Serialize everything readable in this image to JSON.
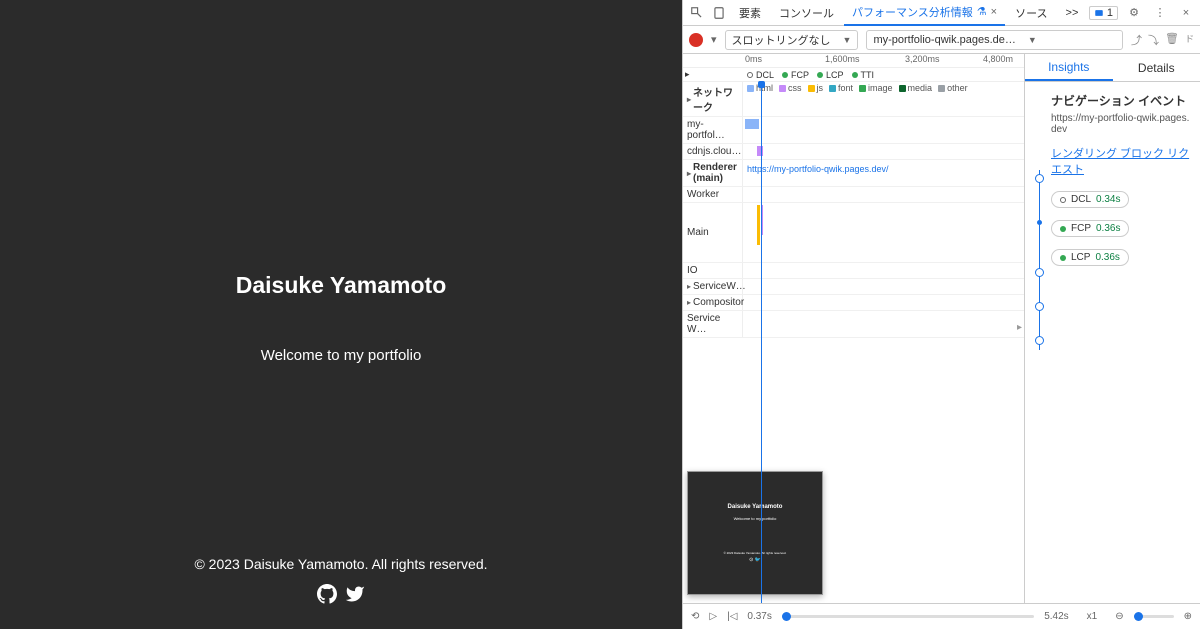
{
  "page": {
    "title": "Daisuke Yamamoto",
    "subtitle": "Welcome to my portfolio",
    "footer": "© 2023 Daisuke Yamamoto. All rights reserved."
  },
  "devtools": {
    "tabs": {
      "elements": "要素",
      "console": "コンソール",
      "perf": "パフォーマンス分析情報",
      "sources": "ソース",
      "more": ">>"
    },
    "warnings": "1",
    "toolbar": {
      "throttling": "スロットリングなし",
      "domain": "my-portfolio-qwik.pages.de…"
    },
    "ruler": {
      "t0": "0ms",
      "t1": "1,600ms",
      "t2": "3,200ms",
      "t3": "4,800m"
    },
    "metrics": {
      "dcl": "DCL",
      "fcp": "FCP",
      "lcp": "LCP",
      "tti": "TTI"
    },
    "tracks": {
      "network": "ネットワーク",
      "netItems": [
        "my-portfol…",
        "cdnjs.clou…"
      ],
      "renderer": "Renderer\n(main)",
      "rendererUrl": "https://my-portfolio-qwik.pages.dev/",
      "worker": "Worker",
      "main": "Main",
      "io": "IO",
      "servicew": "ServiceW…",
      "compositor": "Compositor",
      "servicew2": "Service W…"
    },
    "legend": {
      "html": "html",
      "css": "css",
      "js": "js",
      "font": "font",
      "image": "image",
      "media": "media",
      "other": "other"
    },
    "insights": {
      "tab1": "Insights",
      "tab2": "Details",
      "navTitle": "ナビゲーション イベント",
      "navUrl": "https://my-portfolio-qwik.pages.dev",
      "renderBlock": "レンダリング ブロック リクエスト",
      "dcl": {
        "label": "DCL",
        "time": "0.34s"
      },
      "fcp": {
        "label": "FCP",
        "time": "0.36s"
      },
      "lcp": {
        "label": "LCP",
        "time": "0.36s"
      }
    },
    "bottom": {
      "t1": "0.37s",
      "t2": "5.42s",
      "zoom": "x1"
    },
    "preview": {
      "title": "Daisuke Yamamoto",
      "sub": "Welcome to my portfolio",
      "foot": "© 2023 Daisuke Yamamoto. All rights reserved."
    }
  }
}
